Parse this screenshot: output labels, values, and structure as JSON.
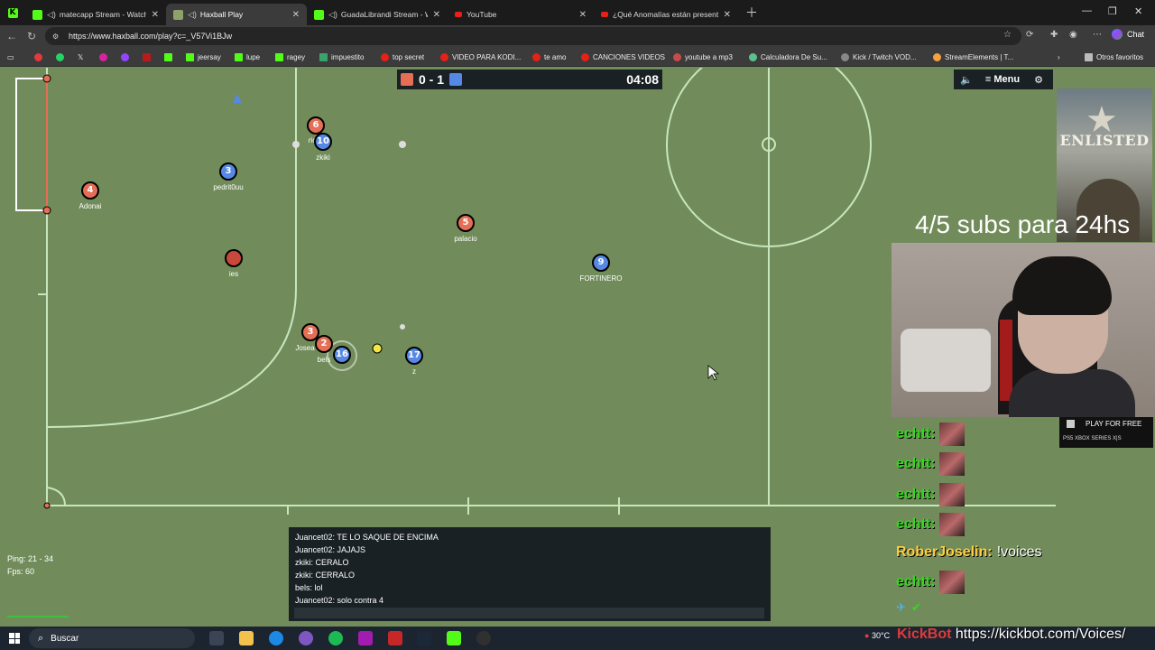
{
  "browser": {
    "tabs": [
      {
        "title": "",
        "active": false
      },
      {
        "title": "matecapp Stream - Watch Liv",
        "active": false
      },
      {
        "title": "Haxball Play",
        "active": true
      },
      {
        "title": "GuadaLibrandi Stream - Watch",
        "active": false
      },
      {
        "title": "YouTube",
        "active": false
      },
      {
        "title": "¿Qué Anomalías están presentes e",
        "active": false
      }
    ],
    "url": "https://www.haxball.com/play?c=_V57Vi1BJw",
    "chat_label": "Chat",
    "bookmarks": [
      "jeersay",
      "lupe",
      "ragey",
      "impuestito",
      "top secret",
      "VIDEO PARA KODI...",
      "te amo",
      "CANCIONES VIDEOS",
      "youtube a mp3",
      "Calculadora De Su...",
      "Kick / Twitch VOD...",
      "StreamElements | T...",
      "Otros favoritos"
    ]
  },
  "game": {
    "score": "0 - 1",
    "timer": "04:08",
    "menu_label": "Menu",
    "red_color": "#e56e56",
    "blue_color": "#5689e5",
    "players": [
      {
        "num": "6",
        "name": "ric",
        "team": "red"
      },
      {
        "num": "10",
        "name": "zkiki",
        "team": "blue"
      },
      {
        "num": "3",
        "name": "pedrit0uu",
        "team": "blue"
      },
      {
        "num": "4",
        "name": "Adonai",
        "team": "red"
      },
      {
        "num": "5",
        "name": "palacio",
        "team": "red"
      },
      {
        "num": "",
        "name": "ies",
        "team": "red"
      },
      {
        "num": "9",
        "name": "FORTINERO",
        "team": "blue"
      },
      {
        "num": "3",
        "name": "Josea",
        "team": "red"
      },
      {
        "num": "2",
        "name": "bels",
        "team": "red"
      },
      {
        "num": "16",
        "name": "",
        "team": "blue"
      },
      {
        "num": "17",
        "name": "z",
        "team": "blue"
      }
    ],
    "ping": "Ping: 21 - 34",
    "fps": "Fps: 60",
    "chat": [
      "Juancet02: TE LO SAQUE DE ENCIMA",
      "Juancet02: JAJAJS",
      "zkiki: CERALO",
      "zkiki: CERRALO",
      "bels: lol",
      "Juancet02: solo contra 4"
    ]
  },
  "overlay": {
    "enlisted_logo": "ENLISTED",
    "subs_goal": "4/5 subs para 24hs",
    "kick_chat": [
      {
        "user": "echtt:",
        "msg": ""
      },
      {
        "user": "echtt:",
        "msg": ""
      },
      {
        "user": "echtt:",
        "msg": ""
      },
      {
        "user": "echtt:",
        "msg": ""
      },
      {
        "user": "RoberJoselin:",
        "msg": "!voices"
      },
      {
        "user": "echtt:",
        "msg": ""
      }
    ],
    "promo": "PLAY FOR FREE",
    "promo_platforms": "PS5   XBOX SERIES X|S",
    "kickbot_brand": "KickBot",
    "kickbot_url": "https://kickbot.com/Voices/"
  },
  "taskbar": {
    "search_placeholder": "Buscar",
    "temp": "30°C"
  }
}
